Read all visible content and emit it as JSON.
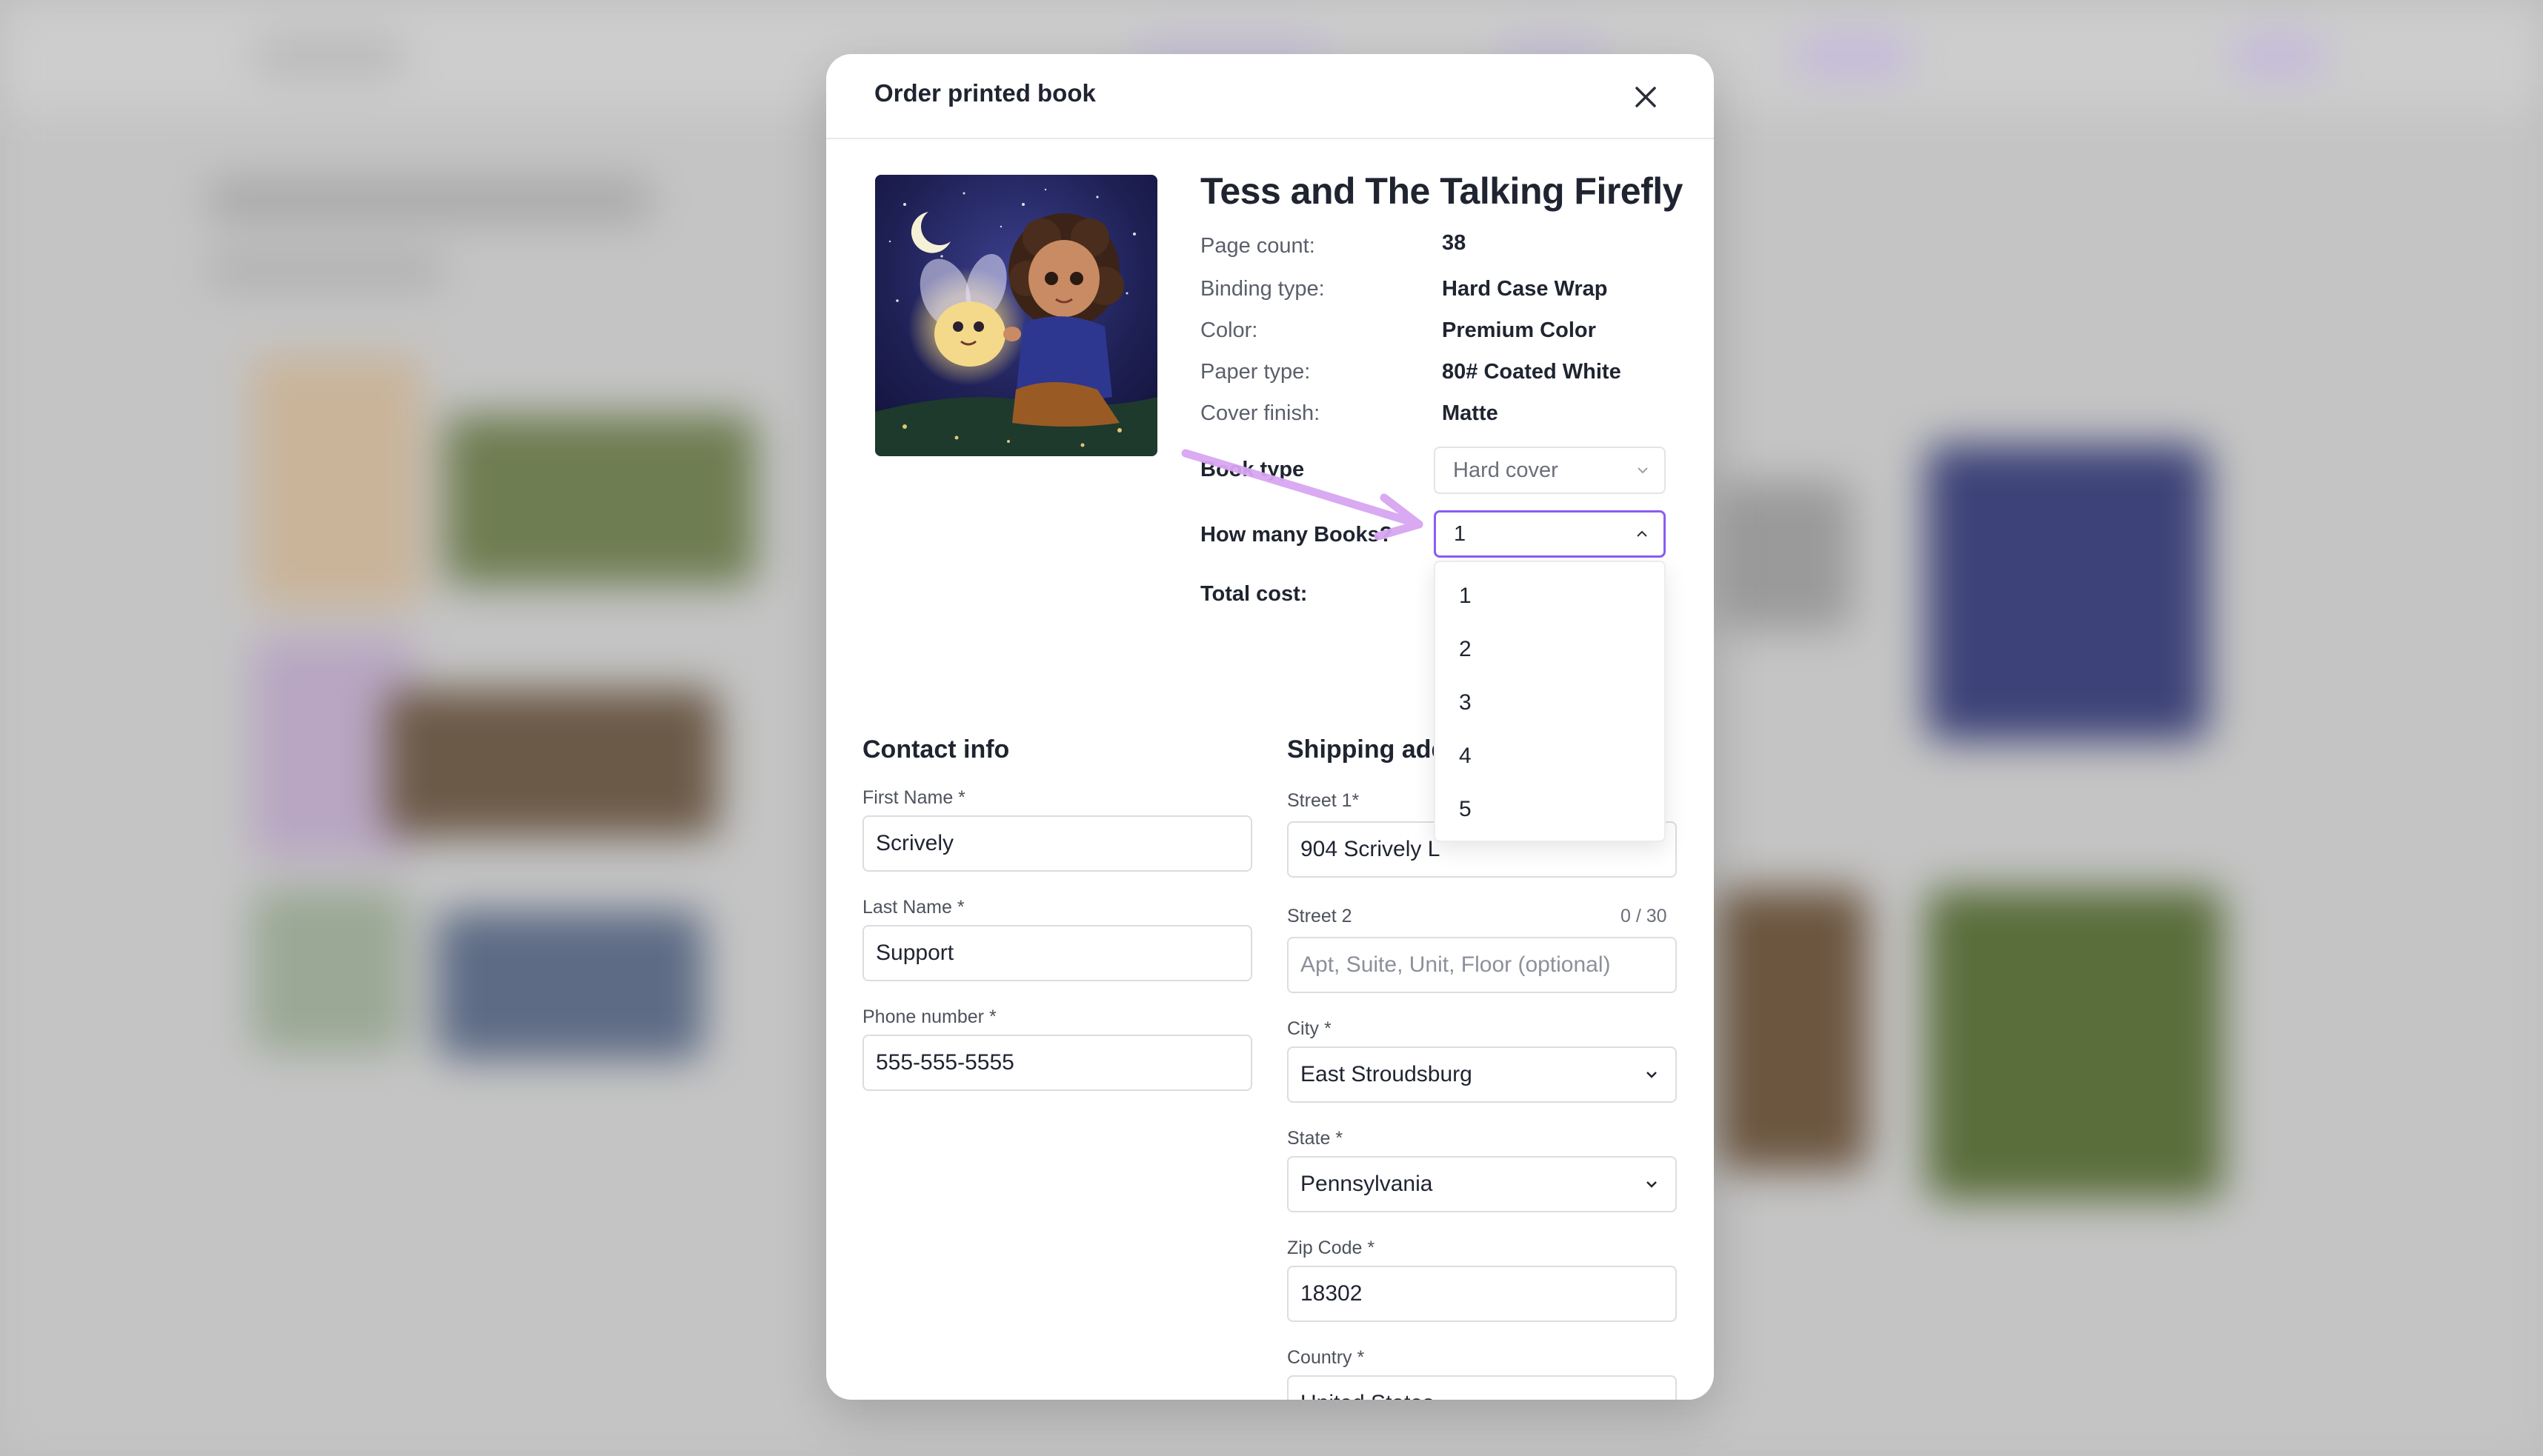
{
  "colors": {
    "accent": "#8b5cf6",
    "annotation_arrow": "#d8a5f2"
  },
  "modal": {
    "title": "Order printed book",
    "close_icon": "close-icon"
  },
  "book": {
    "title": "Tess and The Talking Firefly",
    "specs": [
      {
        "label": "Page count:",
        "value": "38"
      },
      {
        "label": "Binding type:",
        "value": "Hard Case Wrap"
      },
      {
        "label": "Color:",
        "value": "Premium Color"
      },
      {
        "label": "Paper type:",
        "value": "80# Coated White"
      },
      {
        "label": "Cover finish:",
        "value": "Matte"
      }
    ],
    "book_type_label": "Book type",
    "book_type_value": "Hard cover",
    "quantity_label": "How many Books?",
    "quantity_value": "1",
    "quantity_options": [
      "1",
      "2",
      "3",
      "4",
      "5"
    ],
    "total_cost_label": "Total cost:"
  },
  "contact": {
    "heading": "Contact info",
    "first_name_label": "First Name *",
    "first_name_value": "Scrively",
    "last_name_label": "Last Name *",
    "last_name_value": "Support",
    "phone_label": "Phone number *",
    "phone_value": "555-555-5555"
  },
  "shipping": {
    "heading": "Shipping add",
    "street1_label": "Street 1*",
    "street1_value": "904 Scrively L",
    "street2_label": "Street 2",
    "street2_counter": "0 / 30",
    "street2_placeholder": "Apt, Suite, Unit, Floor (optional)",
    "city_label": "City *",
    "city_value": "East Stroudsburg",
    "state_label": "State *",
    "state_value": "Pennsylvania",
    "zip_label": "Zip Code *",
    "zip_value": "18302",
    "country_label": "Country *",
    "country_value": "United States"
  }
}
